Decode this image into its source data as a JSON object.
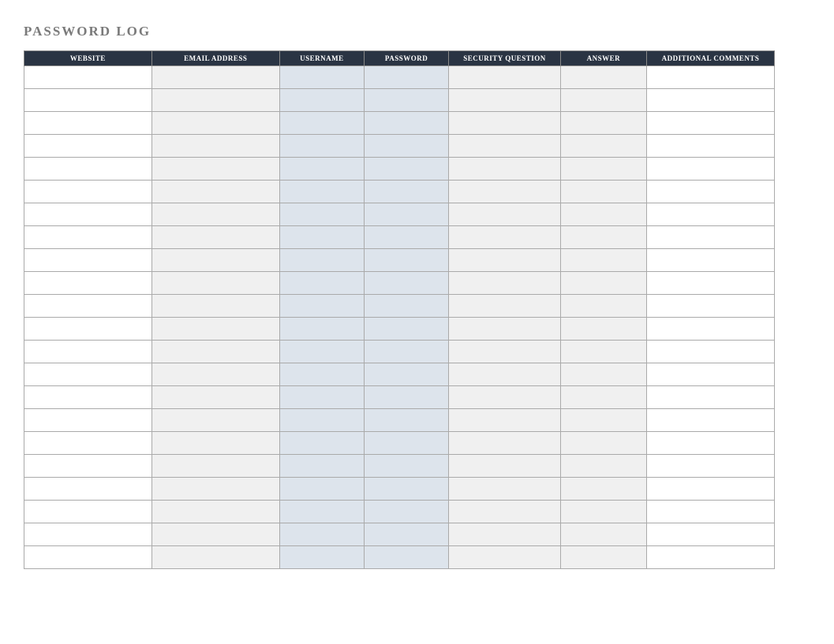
{
  "title": "PASSWORD LOG",
  "columns": [
    {
      "key": "website",
      "label": "WEBSITE",
      "class": "col-website",
      "cell_bg": "bg-white"
    },
    {
      "key": "email",
      "label": "EMAIL ADDRESS",
      "class": "col-email",
      "cell_bg": "bg-gray"
    },
    {
      "key": "username",
      "label": "USERNAME",
      "class": "col-username",
      "cell_bg": "bg-blue"
    },
    {
      "key": "password",
      "label": "PASSWORD",
      "class": "col-password",
      "cell_bg": "bg-blue"
    },
    {
      "key": "security",
      "label": "SECURITY QUESTION",
      "class": "col-security",
      "cell_bg": "bg-gray"
    },
    {
      "key": "answer",
      "label": "ANSWER",
      "class": "col-answer",
      "cell_bg": "bg-gray"
    },
    {
      "key": "comments",
      "label": "ADDITIONAL COMMENTS",
      "class": "col-comments",
      "cell_bg": "bg-white"
    }
  ],
  "row_count": 22,
  "colors": {
    "header_bg": "#2a3443",
    "title_color": "#7a7a7a",
    "gray_cell": "#f0f0f0",
    "blue_cell": "#dde4ec"
  }
}
